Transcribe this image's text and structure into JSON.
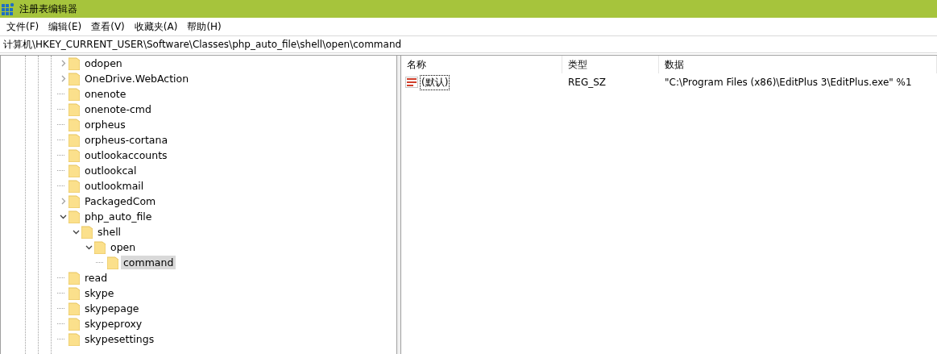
{
  "window": {
    "title": "注册表编辑器"
  },
  "menu": [
    "文件(F)",
    "编辑(E)",
    "查看(V)",
    "收藏夹(A)",
    "帮助(H)"
  ],
  "address": "计算机\\HKEY_CURRENT_USER\\Software\\Classes\\php_auto_file\\shell\\open\\command",
  "tree": [
    {
      "label": "odopen",
      "kind": "collapsed",
      "selected": false
    },
    {
      "label": "OneDrive.WebAction",
      "kind": "collapsed",
      "selected": false
    },
    {
      "label": "onenote",
      "kind": "leaf",
      "selected": false
    },
    {
      "label": "onenote-cmd",
      "kind": "leaf",
      "selected": false
    },
    {
      "label": "orpheus",
      "kind": "leaf",
      "selected": false
    },
    {
      "label": "orpheus-cortana",
      "kind": "leaf",
      "selected": false
    },
    {
      "label": "outlookaccounts",
      "kind": "leaf",
      "selected": false
    },
    {
      "label": "outlookcal",
      "kind": "leaf",
      "selected": false
    },
    {
      "label": "outlookmail",
      "kind": "leaf",
      "selected": false
    },
    {
      "label": "PackagedCom",
      "kind": "collapsed",
      "selected": false
    },
    {
      "label": "php_auto_file",
      "kind": "expanded",
      "selected": false,
      "children": [
        {
          "label": "shell",
          "kind": "expanded",
          "selected": false,
          "children": [
            {
              "label": "open",
              "kind": "expanded",
              "selected": false,
              "children": [
                {
                  "label": "command",
                  "kind": "leaf",
                  "selected": true
                }
              ]
            }
          ]
        }
      ]
    },
    {
      "label": "read",
      "kind": "leaf",
      "selected": false
    },
    {
      "label": "skype",
      "kind": "leaf",
      "selected": false
    },
    {
      "label": "skypepage",
      "kind": "leaf",
      "selected": false
    },
    {
      "label": "skypeproxy",
      "kind": "leaf",
      "selected": false
    },
    {
      "label": "skypesettings",
      "kind": "leaf",
      "selected": false
    }
  ],
  "table": {
    "columns": [
      "名称",
      "类型",
      "数据"
    ],
    "rows": [
      {
        "name": "(默认)",
        "type": "REG_SZ",
        "data": "\"C:\\Program Files (x86)\\EditPlus 3\\EditPlus.exe\" %1",
        "focused": true
      }
    ]
  }
}
